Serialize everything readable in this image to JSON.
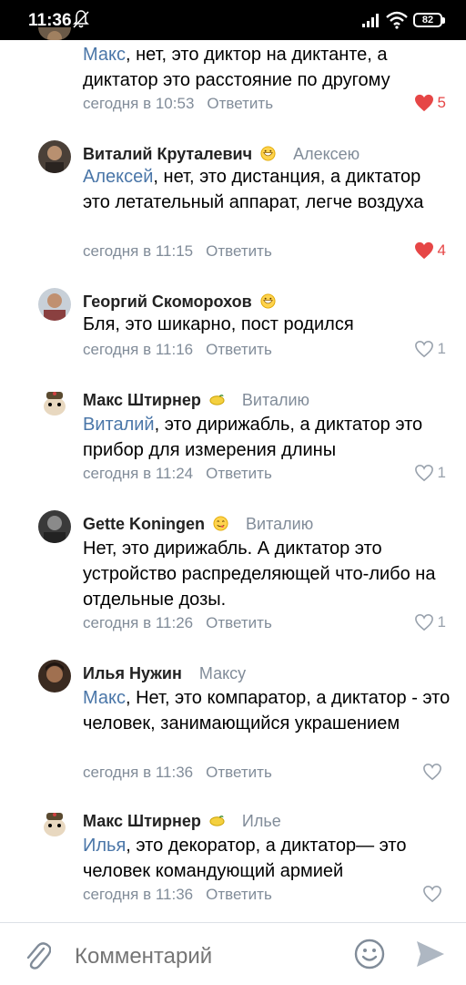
{
  "status_bar": {
    "time": "11:36",
    "battery": "82"
  },
  "reply_label": "Ответить",
  "colors": {
    "accent": "#4a76a8",
    "like_red": "#e64646",
    "muted": "#818c99"
  },
  "comments": [
    {
      "author": "",
      "reply_to": "",
      "mention": "Макс",
      "text": ", нет, это диктор на диктанте, а диктатор это расстояние по другому",
      "time": "сегодня в 10:53",
      "likes": "5",
      "liked": true
    },
    {
      "author": "Виталий Круталевич",
      "emoji": "grinning-face-emoji",
      "reply_to": "Алексею",
      "mention": "Алексей",
      "text": ", нет, это дистанция, а диктатор это летательный аппарат, легче воздуха",
      "time": "сегодня в 11:15",
      "likes": "4",
      "liked": true
    },
    {
      "author": "Георгий Скоморохов",
      "emoji": "grinning-face-emoji",
      "reply_to": "",
      "mention": "",
      "text": "Бля, это шикарно, пост родился",
      "time": "сегодня в 11:16",
      "likes": "1",
      "liked": false
    },
    {
      "author": "Макс Штирнер",
      "emoji": "lemon-emoji",
      "reply_to": "Виталию",
      "mention": "Виталий",
      "text": ", это дирижабль, а диктатор это прибор для измерения длины",
      "time": "сегодня в 11:24",
      "likes": "1",
      "liked": false
    },
    {
      "author": "Gette Koningen",
      "emoji": "yum-face-emoji",
      "reply_to": "Виталию",
      "mention": "",
      "text": "Нет, это дирижабль. А диктатор это устройство распределяющей что-либо на отдельные дозы.",
      "time": "сегодня в 11:26",
      "likes": "1",
      "liked": false
    },
    {
      "author": "Илья Нужин",
      "reply_to": "Максу",
      "mention": "Макс",
      "text": ", Нет, это компаратор, а диктатор - это человек, занимающийся украшением",
      "time": "сегодня в 11:36",
      "likes": "",
      "liked": false
    },
    {
      "author": "Макс Штирнер",
      "emoji": "lemon-emoji",
      "reply_to": "Илье",
      "mention": "Илья",
      "text": ", это декоратор, а диктатор— это человек командующий армией",
      "time": "сегодня в 11:36",
      "likes": "",
      "liked": false
    }
  ],
  "composer": {
    "placeholder": "Комментарий"
  }
}
